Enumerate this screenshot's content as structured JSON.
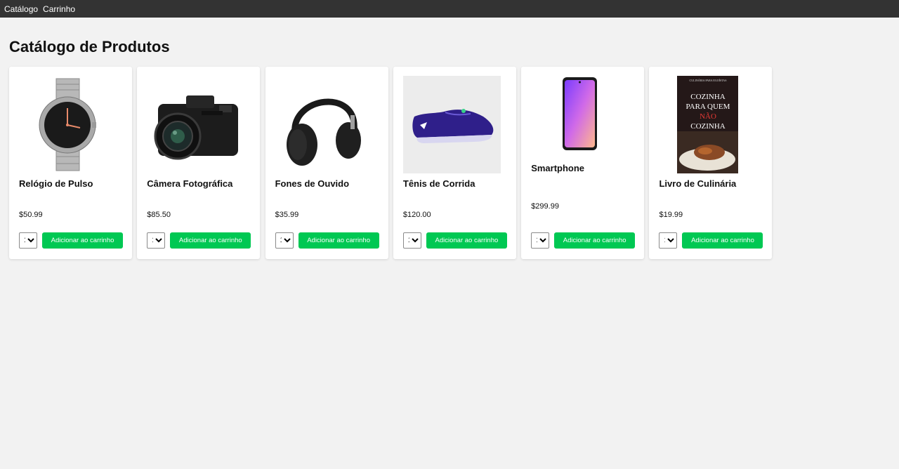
{
  "nav": {
    "catalog": "Catálogo",
    "cart": "Carrinho"
  },
  "page": {
    "title": "Catálogo de Produtos"
  },
  "products": [
    {
      "name": "Relógio de Pulso",
      "price": "$50.99",
      "qty": "1",
      "button": "Adicionar ao carrinho"
    },
    {
      "name": "Câmera Fotográfica",
      "price": "$85.50",
      "qty": "1",
      "button": "Adicionar ao carrinho"
    },
    {
      "name": "Fones de Ouvido",
      "price": "$35.99",
      "qty": "1",
      "button": "Adicionar ao carrinho"
    },
    {
      "name": "Tênis de Corrida",
      "price": "$120.00",
      "qty": "1",
      "button": "Adicionar ao carrinho"
    },
    {
      "name": "Smartphone",
      "price": "$299.99",
      "qty": "1",
      "button": "Adicionar ao carrinho"
    },
    {
      "name": "Livro de Culinária",
      "price": "$19.99",
      "qty": "1",
      "button": "Adicionar ao carrinho",
      "book_cover": {
        "top": "CULINÁRIA PARA EGOÍSTAS",
        "line1": "COZINHA",
        "line2": "PARA QUEM",
        "line3": "NÃO",
        "line4": "COZINHA"
      }
    }
  ],
  "colors": {
    "nav_bg": "#333333",
    "button": "#00c853",
    "page_bg": "#f2f2f2"
  }
}
